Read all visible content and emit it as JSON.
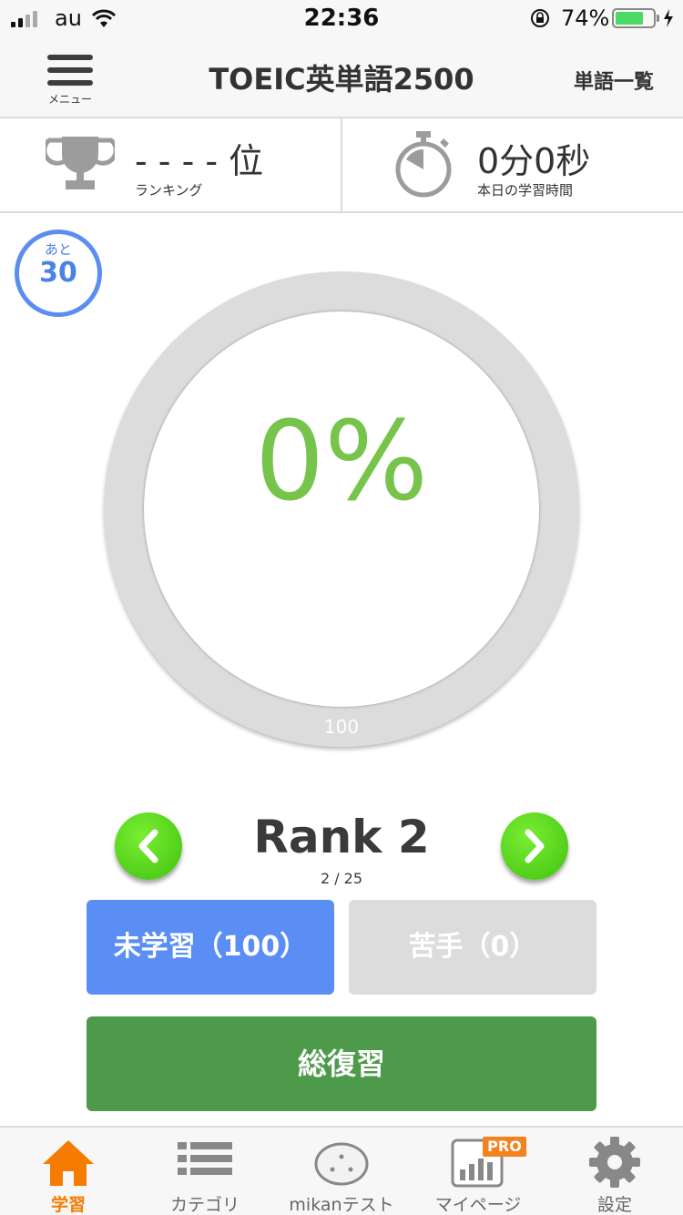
{
  "status_bar": {
    "carrier": "au",
    "time": "22:36",
    "battery_percent": "74%",
    "battery_level": 0.74
  },
  "navbar": {
    "menu_label": "メニュー",
    "title": "TOEIC英単語2500",
    "word_list_label": "単語一覧"
  },
  "info": {
    "ranking_value": "- - - - 位",
    "ranking_label": "ランキング",
    "study_time_value": "0分0秒",
    "study_time_label": "本日の学習時間"
  },
  "remaining": {
    "label": "あと",
    "count": "30"
  },
  "progress": {
    "percent_text": "0%",
    "total": "100",
    "value": 0
  },
  "rank": {
    "title": "Rank 2",
    "position": "2 / 25"
  },
  "buttons": {
    "unlearned": "未学習（100）",
    "weak": "苦手（0）",
    "review": "総復習"
  },
  "tabs": [
    {
      "label": "学習",
      "icon": "home-icon",
      "active": true
    },
    {
      "label": "カテゴリ",
      "icon": "list-icon",
      "active": false
    },
    {
      "label": "mikanテスト",
      "icon": "mikan-icon",
      "active": false
    },
    {
      "label": "マイページ",
      "icon": "chart-icon",
      "active": false,
      "badge": "PRO"
    },
    {
      "label": "設定",
      "icon": "gear-icon",
      "active": false
    }
  ],
  "colors": {
    "accent_orange": "#f57c00",
    "progress_green": "#77c44c",
    "unlearned_blue": "#5a8ef5",
    "review_green": "#4c9a4a",
    "nav_button_green": "#4cd01a"
  }
}
